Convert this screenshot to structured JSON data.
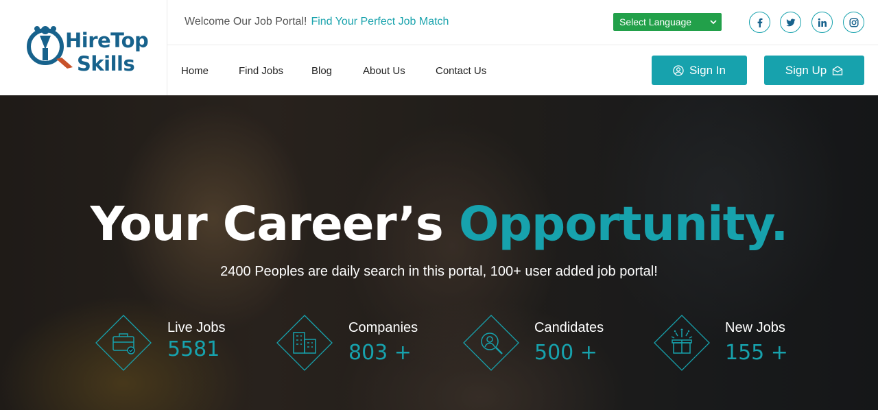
{
  "logo": {
    "line1": "HireTop",
    "line2": "Skills"
  },
  "topbar": {
    "welcome": "Welcome Our Job Portal!",
    "tagline": "Find Your Perfect Job Match",
    "language": "Select Language"
  },
  "social": [
    "facebook-icon",
    "twitter-icon",
    "linkedin-icon",
    "instagram-icon"
  ],
  "nav": {
    "items": [
      {
        "label": "Home"
      },
      {
        "label": "Find Jobs"
      },
      {
        "label": "Blog"
      },
      {
        "label": "About Us"
      },
      {
        "label": "Contact Us"
      }
    ]
  },
  "auth": {
    "sign_in": "Sign In",
    "sign_up": "Sign Up"
  },
  "hero": {
    "title_main": "Your Career’s",
    "title_accent": "Opportunity.",
    "subtitle": "2400 Peoples are daily search in this portal, 100+ user added job portal!"
  },
  "stats": [
    {
      "label": "Live Jobs",
      "value": "5581",
      "icon": "briefcase-icon"
    },
    {
      "label": "Companies",
      "value": "803 +",
      "icon": "building-icon"
    },
    {
      "label": "Candidates",
      "value": "500 +",
      "icon": "candidate-search-icon"
    },
    {
      "label": "New Jobs",
      "value": "155 +",
      "icon": "gift-box-icon"
    }
  ],
  "colors": {
    "accent": "#17a2ad",
    "brand": "#17628c",
    "language": "#22a04a"
  }
}
